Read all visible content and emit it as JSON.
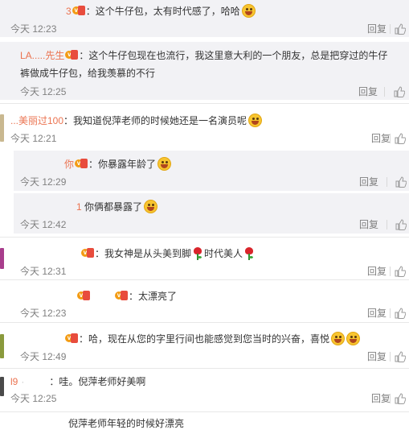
{
  "labels": {
    "reply": "回复"
  },
  "comments": [
    {
      "id": "c1",
      "user": "3",
      "text": "：这个牛仔包，太有时代感了，哈哈",
      "time": "今天 12:23"
    },
    {
      "id": "c2",
      "user": "LA.....先生",
      "text": "：这个牛仔包现在也流行，我这里意大利的一个朋友，总是把穿过的牛仔",
      "text2": "裤做成牛仔包，给我羡慕的不行",
      "time": "今天 12:25"
    },
    {
      "id": "c3",
      "user": "...美丽过100",
      "text": "：我知道倪萍老师的时候她还是一名演员呢",
      "time": "今天 12:21"
    },
    {
      "id": "c4",
      "user": "你",
      "text": "：你暴露年龄了",
      "time": "今天 12:29"
    },
    {
      "id": "c5",
      "user": "1",
      "text": "你俩都暴露了",
      "time": "今天 12:42"
    },
    {
      "id": "c6",
      "user": "",
      "text": "：我女神是从头美到脚",
      "text_mid": "时代美人",
      "time": "今天 12:31"
    },
    {
      "id": "c7",
      "user": "",
      "text": "：太漂亮了",
      "time": "今天 12:23"
    },
    {
      "id": "c8",
      "user": "",
      "text": "：哈，现在从您的字里行间也能感觉到您当时的兴奋，喜悦",
      "time": "今天 12:49"
    },
    {
      "id": "c9",
      "user": "l9",
      "text": "：哇。倪萍老师好美啊",
      "time": "今天 12:25"
    },
    {
      "id": "c10",
      "user": "",
      "text": "倪萍老师年轻的时候好漂亮",
      "time": ""
    }
  ],
  "colors": {
    "username": "#eb7350",
    "meta": "#808080",
    "sub_bg": "#f2f2f5",
    "divider": "#e8e8e8"
  },
  "icons": [
    "vip-badge-icon",
    "laugh-emoji-icon",
    "smile-emoji-icon",
    "rose-icon",
    "thumb-up-icon"
  ]
}
